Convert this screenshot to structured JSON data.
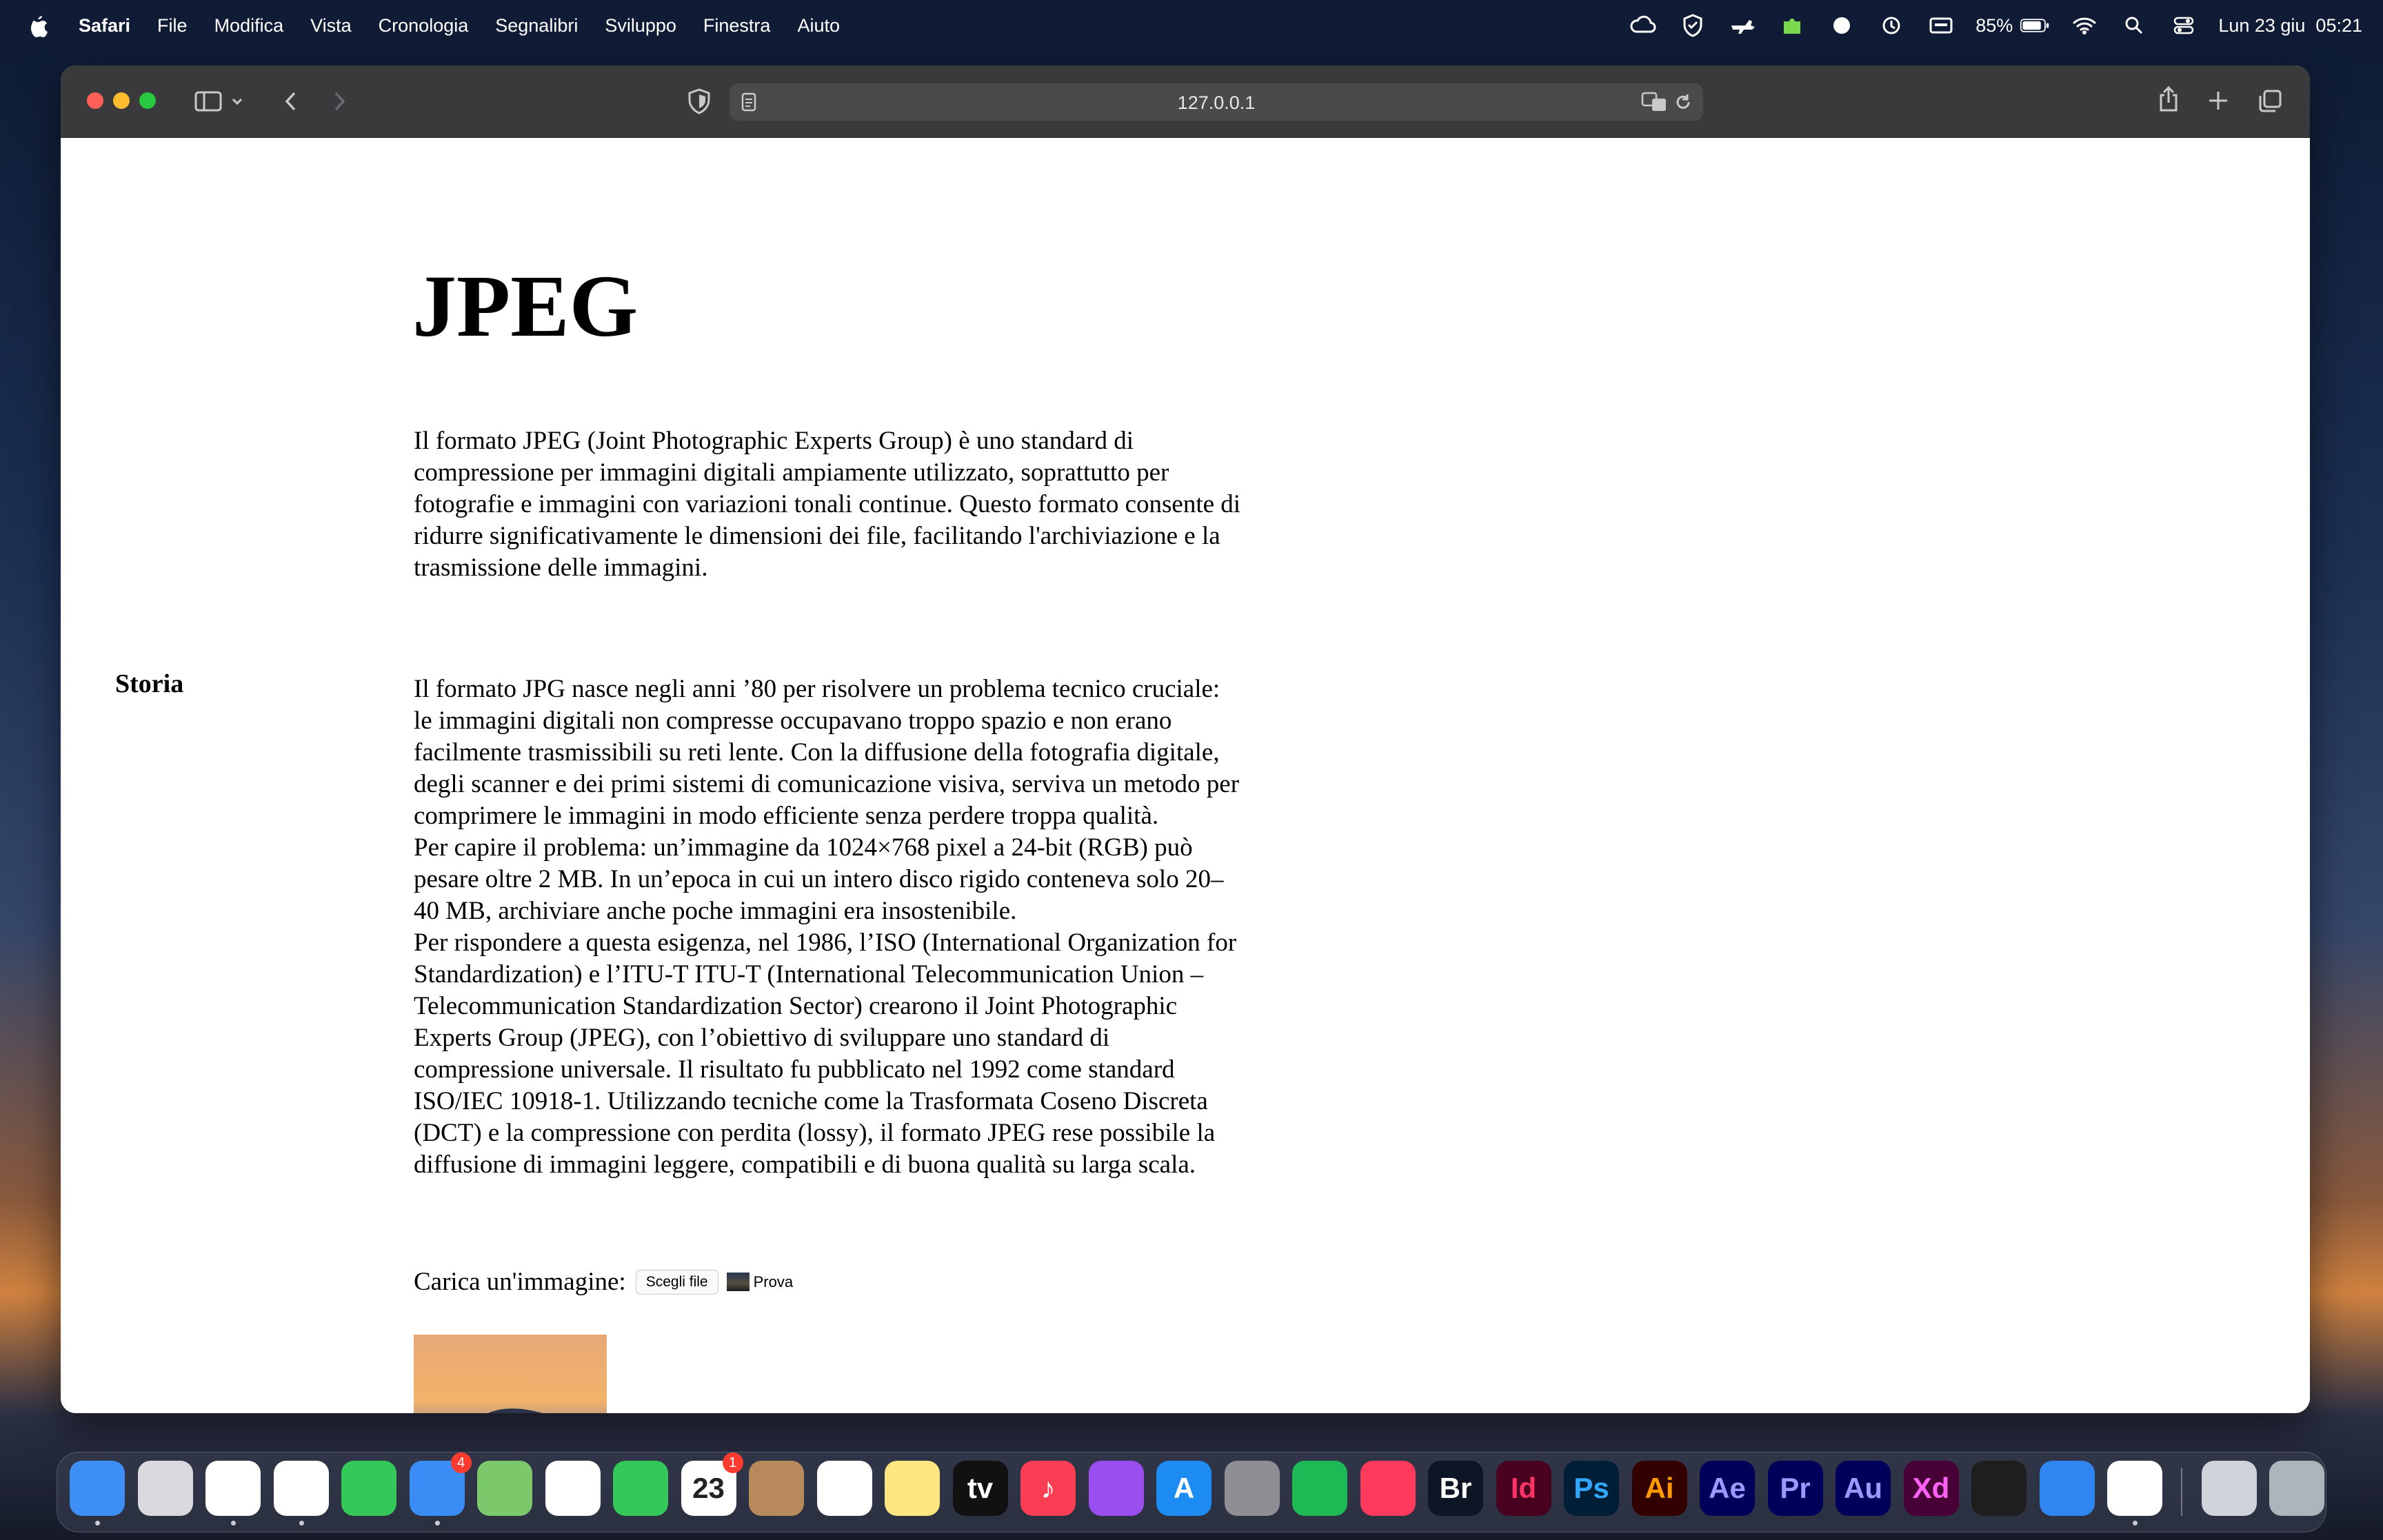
{
  "menubar": {
    "app_name": "Safari",
    "items": [
      "File",
      "Modifica",
      "Vista",
      "Cronologia",
      "Segnalibri",
      "Sviluppo",
      "Finestra",
      "Aiuto"
    ],
    "battery_percent": "85%",
    "datetime": "Lun 23 giu  05:21"
  },
  "browser": {
    "url": "127.0.0.1"
  },
  "page": {
    "title": "JPEG",
    "intro": "Il formato JPEG (Joint Photographic Experts Group) è uno standard di compressione per immagini digitali ampiamente utilizzato, soprattutto per fotografie e immagini con variazioni tonali continue. Questo formato consente di ridurre significativamente le dimensioni dei file, facilitando l'archiviazione e la trasmissione delle immagini.",
    "section_heading": "Storia",
    "history_p1": "Il formato JPG nasce negli anni ’80 per risolvere un problema tecnico cruciale: le immagini digitali non compresse occupavano troppo spazio e non erano facilmente trasmissibili su reti lente. Con la diffusione della fotografia digitale, degli scanner e dei primi sistemi di comunicazione visiva, serviva un metodo per comprimere le immagini in modo efficiente senza perdere troppa qualità.",
    "history_p2": "Per capire il problema: un’immagine da 1024×768 pixel a 24-bit (RGB) può pesare oltre 2 MB. In un’epoca in cui un intero disco rigido conteneva solo 20–40 MB, archiviare anche poche immagini era insostenibile.",
    "history_p3": "Per rispondere a questa esigenza, nel 1986, l’ISO (International Organization for Standardization) e l’ITU-T ITU-T (International Telecommunication Union – Telecommunication Standardization Sector) crearono il Joint Photographic Experts Group (JPEG), con l’obiettivo di sviluppare uno standard di compressione universale. Il risultato fu pubblicato nel 1992 come standard ISO/IEC 10918-1. Utilizzando tecniche come la Trasformata Coseno Discreta (DCT) e la compressione con perdita (lossy), il formato JPEG rese possibile la diffusione di immagini leggere, compatibili e di buona qualità su larga scala.",
    "upload_label": "Carica un'immagine:",
    "choose_button": "Scegli file",
    "file_name": "Prova"
  },
  "dock": {
    "apps": [
      {
        "name": "finder",
        "label": "",
        "bg": "#3d8ef5",
        "fg": "#ffffff",
        "running": true
      },
      {
        "name": "launchpad",
        "label": "",
        "bg": "#d9d9de",
        "fg": "#555555",
        "running": false
      },
      {
        "name": "safari",
        "label": "",
        "bg": "#ffffff",
        "fg": "#1e7cf2",
        "running": true
      },
      {
        "name": "chrome",
        "label": "",
        "bg": "#ffffff",
        "fg": "#e03a2f",
        "running": true
      },
      {
        "name": "messages",
        "label": "",
        "bg": "#34c759",
        "fg": "#ffffff",
        "running": false
      },
      {
        "name": "mail",
        "label": "",
        "bg": "#3a8df5",
        "fg": "#ffffff",
        "running": true,
        "badge": "4"
      },
      {
        "name": "maps",
        "label": "",
        "bg": "#7cc96b",
        "fg": "#ffffff",
        "running": false
      },
      {
        "name": "photos",
        "label": "",
        "bg": "#ffffff",
        "fg": "#f5a623",
        "running": false
      },
      {
        "name": "facetime",
        "label": "",
        "bg": "#34c759",
        "fg": "#ffffff",
        "running": false
      },
      {
        "name": "calendar",
        "label": "23",
        "bg": "#ffffff",
        "fg": "#222222",
        "running": false,
        "badge": "1"
      },
      {
        "name": "contacts",
        "label": "",
        "bg": "#b8895a",
        "fg": "#ffffff",
        "running": false
      },
      {
        "name": "reminders",
        "label": "",
        "bg": "#ffffff",
        "fg": "#f5a623",
        "running": false
      },
      {
        "name": "notes",
        "label": "",
        "bg": "#ffe680",
        "fg": "#ffffff",
        "running": false
      },
      {
        "name": "apple-tv",
        "label": "tv",
        "bg": "#111111",
        "fg": "#ffffff",
        "running": false
      },
      {
        "name": "music",
        "label": "♪",
        "bg": "#fa3e54",
        "fg": "#ffffff",
        "running": false
      },
      {
        "name": "podcasts",
        "label": "",
        "bg": "#9a4ef0",
        "fg": "#ffffff",
        "running": false
      },
      {
        "name": "app-store",
        "label": "A",
        "bg": "#1d8cf2",
        "fg": "#ffffff",
        "running": false
      },
      {
        "name": "system-settings",
        "label": "",
        "bg": "#8e8e93",
        "fg": "#ffffff",
        "running": false
      },
      {
        "name": "spotify",
        "label": "",
        "bg": "#1db954",
        "fg": "#111111",
        "running": false
      },
      {
        "name": "creative-cloud",
        "label": "",
        "bg": "#ff3a5c",
        "fg": "#ffffff",
        "running": false
      },
      {
        "name": "bridge",
        "label": "Br",
        "bg": "#0e1626",
        "fg": "#ffffff",
        "running": false
      },
      {
        "name": "indesign",
        "label": "Id",
        "bg": "#49021f",
        "fg": "#ff3366",
        "running": false
      },
      {
        "name": "photoshop",
        "label": "Ps",
        "bg": "#001e36",
        "fg": "#31a8ff",
        "running": false
      },
      {
        "name": "illustrator",
        "label": "Ai",
        "bg": "#330000",
        "fg": "#ff9a00",
        "running": false
      },
      {
        "name": "after-effects",
        "label": "Ae",
        "bg": "#00005b",
        "fg": "#9999ff",
        "running": false
      },
      {
        "name": "premiere",
        "label": "Pr",
        "bg": "#00005b",
        "fg": "#9999ff",
        "running": false
      },
      {
        "name": "audition",
        "label": "Au",
        "bg": "#00005b",
        "fg": "#9999ff",
        "running": false
      },
      {
        "name": "xd",
        "label": "Xd",
        "bg": "#470137",
        "fg": "#ff61f6",
        "running": false
      },
      {
        "name": "figma",
        "label": "",
        "bg": "#1e1e1e",
        "fg": "#ffffff",
        "running": false
      },
      {
        "name": "migration",
        "label": "",
        "bg": "#2f86f0",
        "fg": "#ffffff",
        "running": false
      },
      {
        "name": "vscode",
        "label": "",
        "bg": "#ffffff",
        "fg": "#1f8ad2",
        "running": true
      },
      {
        "name": "downloads",
        "label": "",
        "bg": "#cfd3da",
        "fg": "#444444",
        "running": false
      },
      {
        "name": "trash",
        "label": "",
        "bg": "#aeb4bc",
        "fg": "#555555",
        "running": false
      }
    ]
  }
}
